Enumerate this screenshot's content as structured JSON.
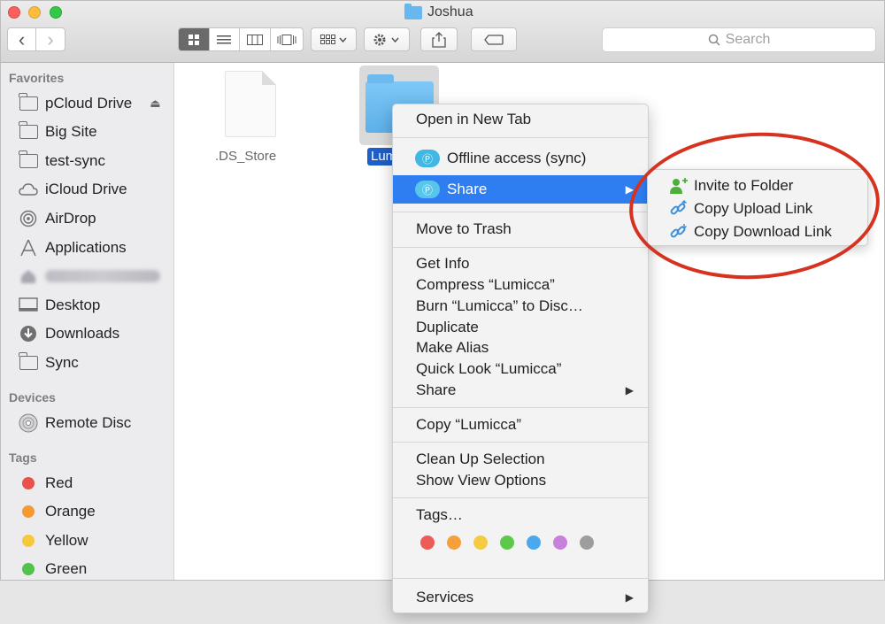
{
  "window": {
    "title": "Joshua"
  },
  "toolbar": {
    "back_glyph": "‹",
    "forward_glyph": "›",
    "search_placeholder": "Search"
  },
  "sidebar": {
    "favorites_title": "Favorites",
    "favorites": [
      {
        "label": "pCloud Drive",
        "icon": "folder-icon",
        "eject": "⏏"
      },
      {
        "label": "Big Site",
        "icon": "folder-icon"
      },
      {
        "label": "test-sync",
        "icon": "folder-icon"
      },
      {
        "label": "iCloud Drive",
        "icon": "cloud-icon"
      },
      {
        "label": "AirDrop",
        "icon": "airdrop-icon"
      },
      {
        "label": "Applications",
        "icon": "applications-icon"
      },
      {
        "label": "",
        "icon": "home-icon"
      },
      {
        "label": "Desktop",
        "icon": "desktop-icon"
      },
      {
        "label": "Downloads",
        "icon": "downloads-icon"
      },
      {
        "label": "Sync",
        "icon": "folder-icon"
      }
    ],
    "devices_title": "Devices",
    "devices": [
      {
        "label": "Remote Disc",
        "icon": "disc-icon"
      }
    ],
    "tags_title": "Tags",
    "tags": [
      {
        "label": "Red",
        "color": "#e9524a"
      },
      {
        "label": "Orange",
        "color": "#f49a32"
      },
      {
        "label": "Yellow",
        "color": "#f5c93b"
      },
      {
        "label": "Green",
        "color": "#53c24a"
      }
    ]
  },
  "files": [
    {
      "name": ".DS_Store",
      "kind": "document-icon"
    },
    {
      "name": "Lumi",
      "kind": "folder-icon",
      "selected": true
    }
  ],
  "context_menu": {
    "open_new_tab": "Open in New Tab",
    "offline_access": "Offline access (sync)",
    "share_pcloud": "Share",
    "move_to_trash": "Move to Trash",
    "get_info": "Get Info",
    "compress": "Compress “Lumicca”",
    "burn": "Burn “Lumicca” to Disc…",
    "duplicate": "Duplicate",
    "make_alias": "Make Alias",
    "quick_look": "Quick Look “Lumicca”",
    "share": "Share",
    "copy": "Copy “Lumicca”",
    "clean_up": "Clean Up Selection",
    "view_options": "Show View Options",
    "tags": "Tags…",
    "tag_colors": [
      "#ee5c58",
      "#f5a03b",
      "#f5cb42",
      "#5cc94b",
      "#4aa9ed",
      "#c980dc",
      "#9d9d9d"
    ],
    "services": "Services",
    "arrow_glyph": "▶"
  },
  "share_submenu": {
    "invite": "Invite to Folder",
    "upload_link": "Copy Upload Link",
    "download_link": "Copy Download Link"
  },
  "annotation": {
    "color": "#d6321f"
  }
}
